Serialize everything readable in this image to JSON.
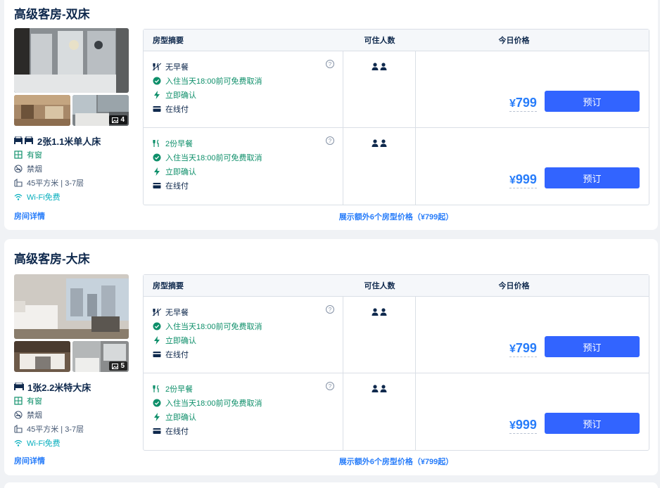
{
  "headers": {
    "summary": "房型摘要",
    "occupancy": "可住人数",
    "price": "今日价格"
  },
  "colors": {
    "accent": "#287dfa",
    "button": "#3264ff",
    "green": "#0e8f6a"
  },
  "rooms": [
    {
      "title": "高级客房-双床",
      "photo_count": "4",
      "bed": "2张1.1米单人床",
      "window": "有窗",
      "smoking": "禁烟",
      "area": "45平方米 | 3-7层",
      "wifi": "Wi-Fi免费",
      "detail_link": "房间详情",
      "more_link": "展示额外6个房型价格（¥799起）",
      "rates": [
        {
          "meal": "无早餐",
          "cancel": "入住当天18:00前可免费取消",
          "confirm": "立即确认",
          "pay": "在线付",
          "currency": "¥",
          "price": "799",
          "book": "预订"
        },
        {
          "meal": "2份早餐",
          "cancel": "入住当天18:00前可免费取消",
          "confirm": "立即确认",
          "pay": "在线付",
          "currency": "¥",
          "price": "999",
          "book": "预订"
        }
      ]
    },
    {
      "title": "高级客房-大床",
      "photo_count": "5",
      "bed": "1张2.2米特大床",
      "window": "有窗",
      "smoking": "禁烟",
      "area": "45平方米 | 3-7层",
      "wifi": "Wi-Fi免费",
      "detail_link": "房间详情",
      "more_link": "展示额外6个房型价格（¥799起）",
      "rates": [
        {
          "meal": "无早餐",
          "cancel": "入住当天18:00前可免费取消",
          "confirm": "立即确认",
          "pay": "在线付",
          "currency": "¥",
          "price": "799",
          "book": "预订"
        },
        {
          "meal": "2份早餐",
          "cancel": "入住当天18:00前可免费取消",
          "confirm": "立即确认",
          "pay": "在线付",
          "currency": "¥",
          "price": "999",
          "book": "预订"
        }
      ]
    }
  ]
}
